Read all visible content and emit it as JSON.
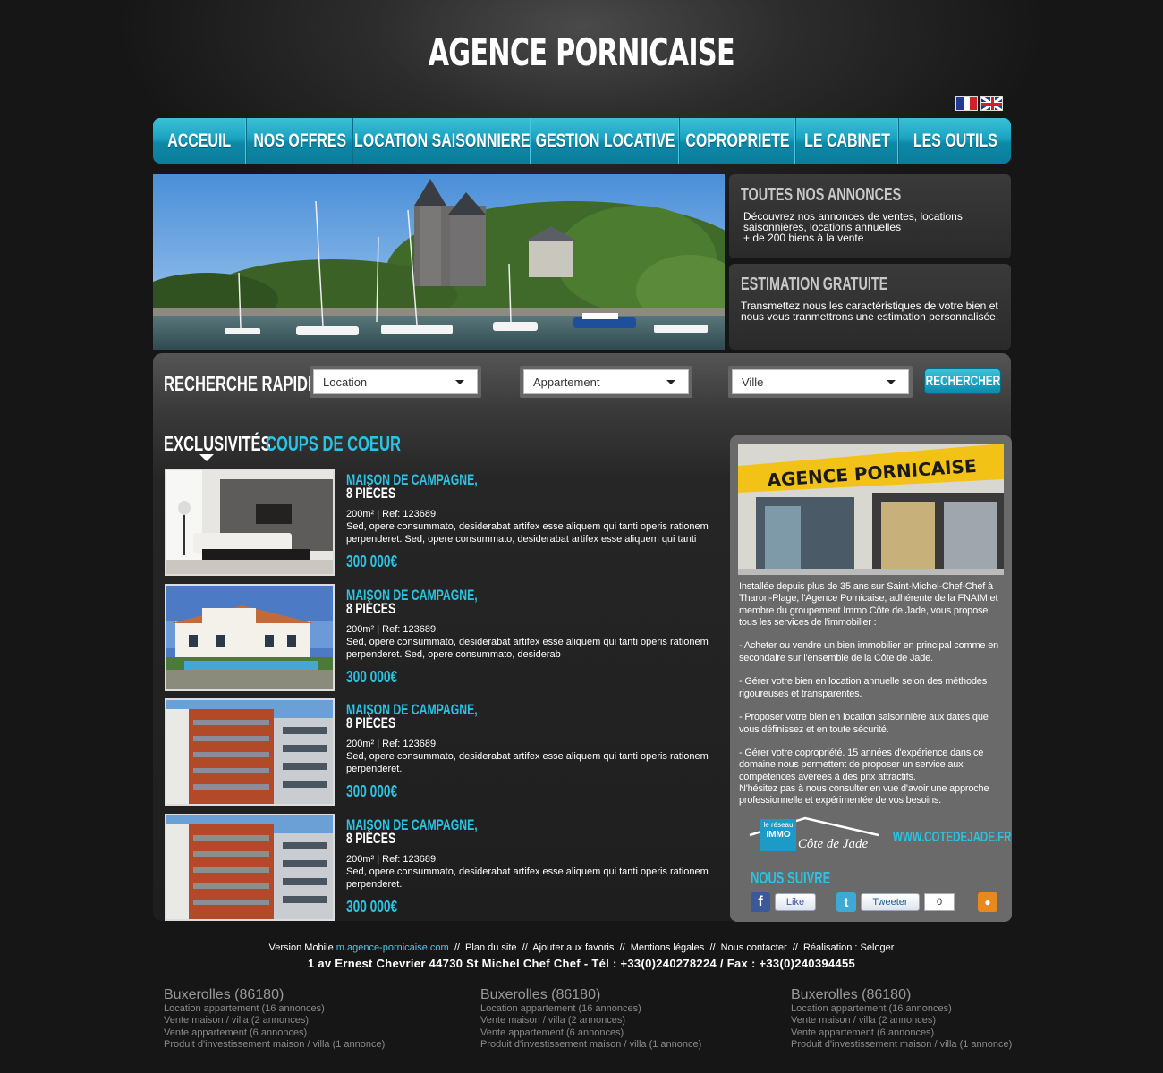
{
  "site": {
    "title": "AGENCE PORNICAISE"
  },
  "colors": {
    "accent": "#2bc3e3",
    "nav_top": "#3cc0d8",
    "nav_bottom": "#0a7d9b",
    "panel": "#6a6a6a"
  },
  "nav": {
    "items": [
      "ACCEUIL",
      "NOS OFFRES",
      "LOCATION SAISONNIERE",
      "GESTION LOCATIVE",
      "COPROPRIETE",
      "LE CABINET",
      "LES OUTILS"
    ]
  },
  "side_boxes": [
    {
      "title": "TOUTES NOS ANNONCES",
      "text": "Découvrez nos annonces de ventes, locations saisonnières, locations annuelles\n+ de 200 biens à la vente"
    },
    {
      "title": "ESTIMATION GRATUITE",
      "text": "Transmettez nous les caractéristiques de votre bien et nous vous tranmettrons une estimation personnalisée."
    }
  ],
  "search": {
    "label": "RECHERCHE RAPIDE",
    "selects": [
      "Location",
      "Appartement",
      "Ville"
    ],
    "button": "RECHERCHER"
  },
  "tabs": {
    "active": "EXCLUSIVITÉS",
    "inactive": "COUPS DE COEUR"
  },
  "listings": [
    {
      "title": "MAISON DE CAMPAGNE,",
      "rooms": "8 PIÈCES",
      "meta": "200m² | Ref: 123689",
      "desc": "Sed, opere consummato, desiderabat artifex esse aliquem qui tanti operis rationem perpenderet. Sed, opere consummato, desiderabat artifex esse aliquem qui tanti",
      "price": "300 000€",
      "image": "living-room"
    },
    {
      "title": "MAISON DE CAMPAGNE,",
      "rooms": "8 PIÈCES",
      "meta": "200m² | Ref: 123689",
      "desc": "Sed, opere consummato, desiderabat artifex esse aliquem qui tanti operis rationem perpenderet. Sed, opere consummato, desiderab",
      "price": "300 000€",
      "image": "villa-pool"
    },
    {
      "title": "MAISON DE CAMPAGNE,",
      "rooms": "8 PIÈCES",
      "meta": "200m² | Ref: 123689",
      "desc": "Sed, opere consummato, desiderabat artifex esse aliquem qui tanti operis rationem perpenderet.",
      "price": "300 000€",
      "image": "apartment-building"
    },
    {
      "title": "MAISON DE CAMPAGNE,",
      "rooms": "8 PIÈCES",
      "meta": "200m² | Ref: 123689",
      "desc": "Sed, opere consummato, desiderabat artifex esse aliquem qui tanti operis rationem perpenderet.",
      "price": "300 000€",
      "image": "apartment-building"
    }
  ],
  "agency": {
    "photo_sign": "AGENCE PORNICAISE",
    "text": "Installée depuis plus de 35 ans sur Saint-Michel-Chef-Chef à Tharon-Plage, l'Agence Pornicaise, adhérente de la FNAIM et membre du groupement Immo Côte de Jade, vous propose tous les services de l'immobilier :\n\n- Acheter ou vendre un bien immobilier en principal comme en secondaire sur l'ensemble de la Côte de Jade.\n\n- Gérer votre bien en location annuelle selon des méthodes rigoureuses et transparentes.\n\n- Proposer votre bien en location saisonnière aux dates que vous définissez et en toute sécurité.\n\n- Gérer votre copropriété. 15 années d'expérience dans ce domaine nous permettent de proposer un service aux compétences avérées à des prix attractifs.\nN'hésitez pas à nous consulter en vue d'avoir une approche professionnelle et expérimentée de vos besoins.",
    "logo_line1": "le réseau",
    "logo_line2": "IMMO",
    "logo_line3": "Côte de Jade",
    "site_link": "WWW.COTEDEJADE.FR",
    "follow": "NOUS SUIVRE",
    "like_label": "Like",
    "tweet_label": "Tweeter",
    "tweet_count": "0"
  },
  "footer": {
    "version_prefix": "Version Mobile",
    "mobile_link": "m.agence-pornicaise.com",
    "links": [
      "Plan du site",
      "Ajouter aux favoris",
      "Mentions légales",
      "Nous contacter",
      "Réalisation : Seloger"
    ],
    "address": "1 av Ernest Chevrier 44730 St Michel Chef Chef - Tél : +33(0)240278224 / Fax : +33(0)240394455"
  },
  "seo_columns": [
    {
      "city": "Buxerolles (86180)",
      "items": [
        "Location appartement (16 annonces)",
        "Vente maison / villa (2 annonces)",
        "Vente appartement (6 annonces)",
        "Produit d'investissement maison / villa (1 annonce)"
      ]
    },
    {
      "city": "Buxerolles (86180)",
      "items": [
        "Location appartement (16 annonces)",
        "Vente maison / villa (2 annonces)",
        "Vente appartement (6 annonces)",
        "Produit d'investissement maison / villa (1 annonce)"
      ]
    },
    {
      "city": "Buxerolles (86180)",
      "items": [
        "Location appartement (16 annonces)",
        "Vente maison / villa (2 annonces)",
        "Vente appartement (6 annonces)",
        "Produit d'investissement maison / villa (1 annonce)"
      ]
    }
  ]
}
